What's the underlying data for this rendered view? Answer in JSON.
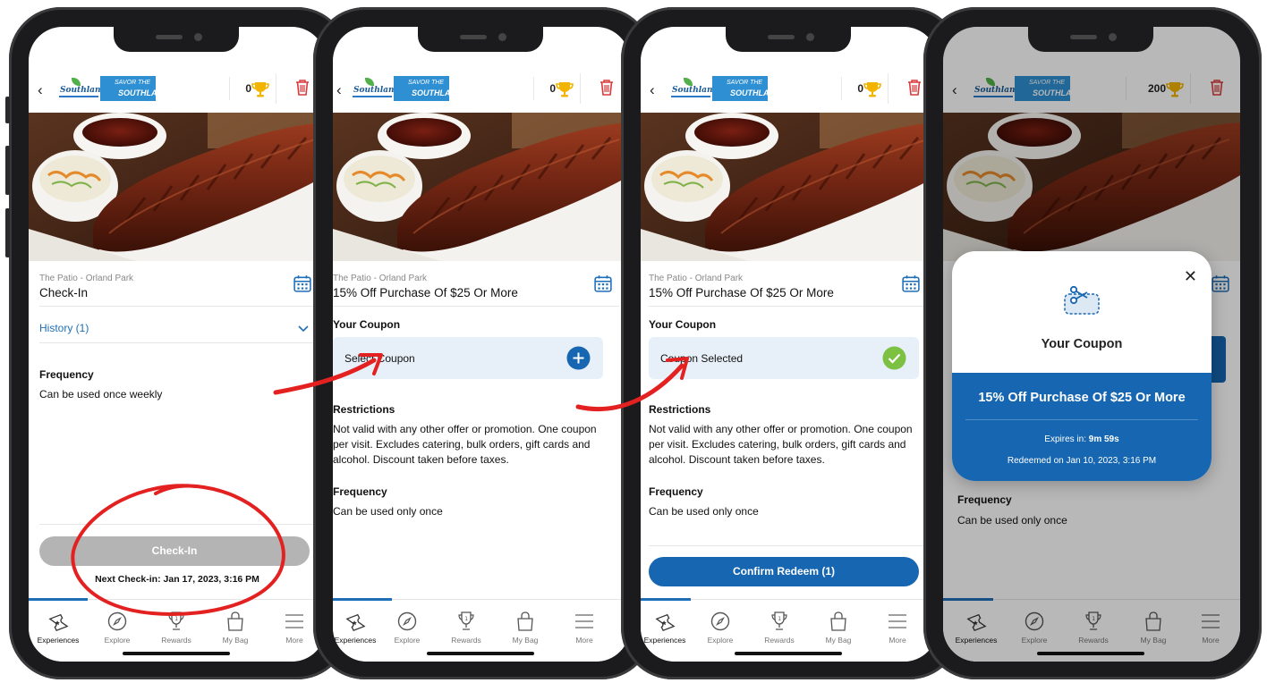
{
  "colors": {
    "brand_blue": "#1666b2",
    "link_blue": "#1f6fb8",
    "select_bg": "#e7f0f8",
    "success": "#7cc142",
    "disabled": "#b4b4b4",
    "annotation_red": "#e32121",
    "trash_red": "#d93a3a",
    "trophy": "#f2b400"
  },
  "header": {
    "back_glyph": "‹",
    "logo_left": "Southland",
    "logo_right_top": "SAVOR THE",
    "logo_right_bottom": "SOUTHLAND"
  },
  "tabs": [
    {
      "label": "Experiences",
      "icon": "ticket-icon"
    },
    {
      "label": "Explore",
      "icon": "compass-icon"
    },
    {
      "label": "Rewards",
      "icon": "trophy-icon"
    },
    {
      "label": "My Bag",
      "icon": "bag-icon"
    },
    {
      "label": "More",
      "icon": "menu-icon"
    }
  ],
  "phone1": {
    "points": "0",
    "location": "The Patio - Orland Park",
    "title": "Check-In",
    "history": "History (1)",
    "frequency_heading": "Frequency",
    "frequency_text": "Can be used once weekly",
    "button": "Check-In",
    "next_checkin": "Next Check-in: Jan 17, 2023, 3:16 PM"
  },
  "phone2": {
    "points": "0",
    "location": "The Patio - Orland Park",
    "title": "15% Off Purchase Of $25 Or More",
    "coupon_heading": "Your Coupon",
    "coupon_label": "Select Coupon",
    "restrictions_heading": "Restrictions",
    "restrictions_text": "Not valid with any other offer or promotion. One coupon per visit. Excludes catering, bulk orders, gift cards and alcohol. Discount taken before taxes.",
    "frequency_heading": "Frequency",
    "frequency_text": "Can be used only once"
  },
  "phone3": {
    "points": "0",
    "location": "The Patio - Orland Park",
    "title": "15% Off Purchase Of $25 Or More",
    "coupon_heading": "Your Coupon",
    "coupon_label": "Coupon Selected",
    "restrictions_heading": "Restrictions",
    "restrictions_text": "Not valid with any other offer or promotion. One coupon per visit. Excludes catering, bulk orders, gift cards and alcohol. Discount taken before taxes.",
    "frequency_heading": "Frequency",
    "frequency_text": "Can be used only once",
    "button": "Confirm Redeem (1)"
  },
  "phone4": {
    "points": "200",
    "frequency_heading": "Frequency",
    "frequency_text": "Can be used only once",
    "modal": {
      "close_glyph": "✕",
      "title": "Your Coupon",
      "offer": "15% Off Purchase Of $25 Or More",
      "expires_label": "Expires in:",
      "expires_value": "9m 59s",
      "redeemed": "Redeemed on Jan 10, 2023, 3:16 PM"
    }
  }
}
